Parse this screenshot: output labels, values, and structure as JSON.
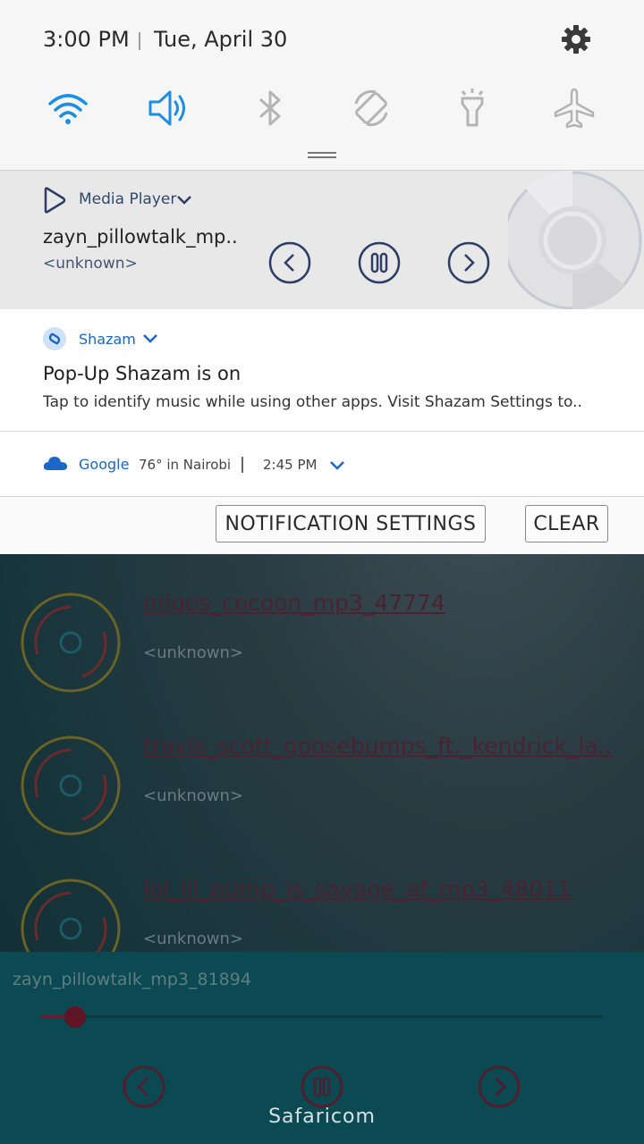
{
  "background_app": {
    "tracks": [
      {
        "title": "migos_cocoon_mp3_47774",
        "artist": "<unknown>"
      },
      {
        "title": "travis_scott_goosebumps_ft._kendrick_la..",
        "artist": "<unknown>"
      },
      {
        "title": "lol_lil_pump_is_savage_af_mp3_48011",
        "artist": "<unknown>"
      }
    ],
    "now_playing": {
      "title": "zayn_pillowtalk_mp3_81894",
      "progress": 0.06
    },
    "carrier": "Safaricom"
  },
  "status": {
    "time": "3:00 PM",
    "date": "Tue, April 30"
  },
  "quick_settings": [
    {
      "name": "wifi",
      "icon": "wifi-icon",
      "active": true
    },
    {
      "name": "sound",
      "icon": "volume-icon",
      "active": true
    },
    {
      "name": "bluetooth",
      "icon": "bluetooth-icon",
      "active": false
    },
    {
      "name": "auto-rotate",
      "icon": "rotate-icon",
      "active": false
    },
    {
      "name": "flashlight",
      "icon": "flashlight-icon",
      "active": false
    },
    {
      "name": "airplane",
      "icon": "airplane-icon",
      "active": false
    }
  ],
  "media_notification": {
    "app": "Media Player",
    "title": "zayn_pillowtalk_mp..",
    "artist": "<unknown>"
  },
  "shazam_notification": {
    "app": "Shazam",
    "title": "Pop-Up Shazam is on",
    "text": "Tap to identify music while using other apps. Visit Shazam Settings to.."
  },
  "google_notification": {
    "app": "Google",
    "weather": "76° in Nairobi",
    "time": "2:45 PM"
  },
  "actions": {
    "settings_label": "NOTIFICATION SETTINGS",
    "clear_label": "CLEAR"
  },
  "colors": {
    "accent_blue": "#1b8ee6",
    "media_icon": "#2c3e66",
    "inactive_icon": "#b4b4b4"
  }
}
